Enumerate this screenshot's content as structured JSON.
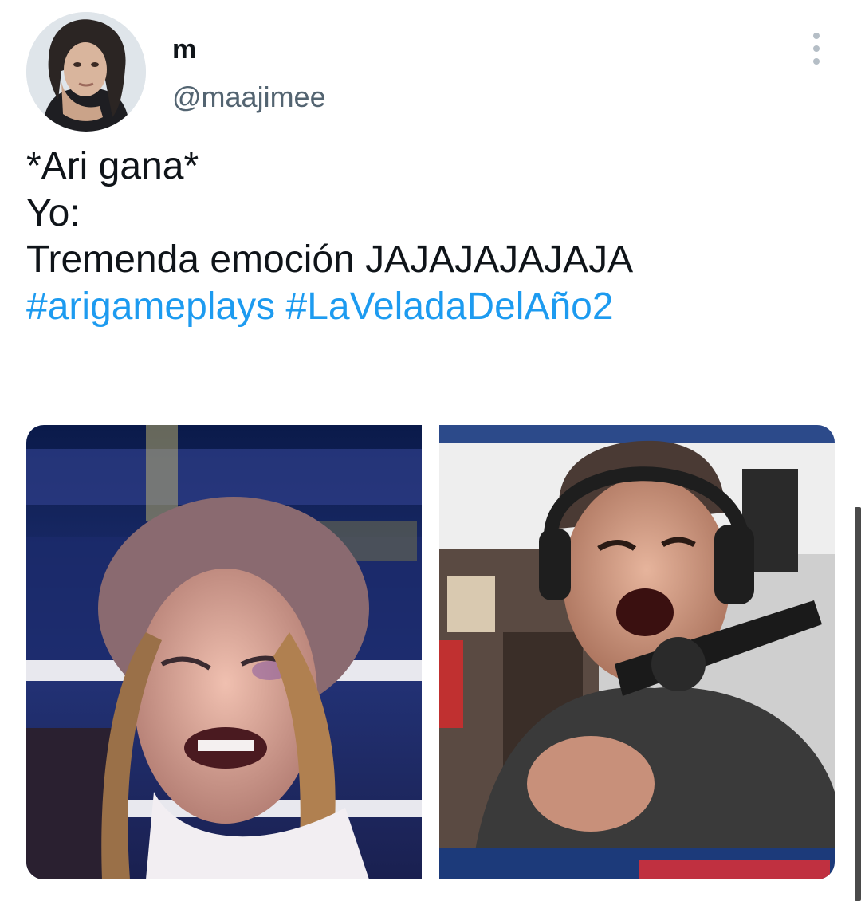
{
  "author": {
    "display_name": "m",
    "handle": "@maajimee",
    "avatar_icon": "user-avatar"
  },
  "tweet": {
    "lines": [
      "*Ari gana*",
      "Yo:",
      "Tremenda emoción JAJAJAJAJAJA"
    ],
    "hashtags": [
      "#arigameplays",
      "#LaVeladaDelAño2"
    ]
  },
  "media": [
    {
      "icon": "photo-boxer-crying"
    },
    {
      "icon": "photo-streamer-shouting"
    }
  ],
  "colors": {
    "text": "#0f1419",
    "secondary": "#536471",
    "hashtag": "#1d9bf0"
  },
  "menu_icon": "more-options-icon"
}
